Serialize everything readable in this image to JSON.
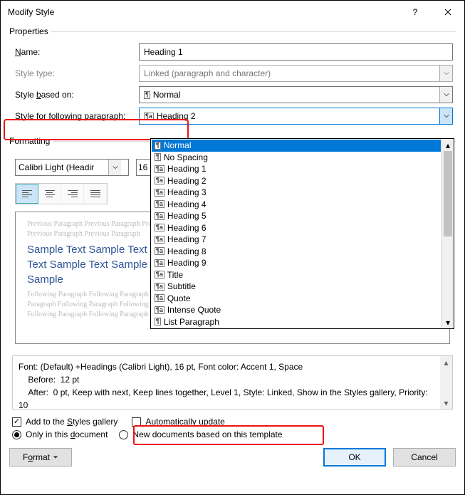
{
  "title": "Modify Style",
  "propsLegend": "Properties",
  "labels": {
    "name": "Name:",
    "type": "Style type:",
    "based": "Style based on:",
    "follow": "Style for following paragraph:"
  },
  "values": {
    "name": "Heading 1",
    "type": "Linked (paragraph and character)",
    "based": "Normal",
    "follow": "Heading 2"
  },
  "dropdownItems": [
    {
      "label": "Normal",
      "sel": true,
      "icon": "pilnormal"
    },
    {
      "label": "No Spacing",
      "icon": "pilnormal"
    },
    {
      "label": "Heading 1",
      "icon": "pil"
    },
    {
      "label": "Heading 2",
      "icon": "pil"
    },
    {
      "label": "Heading 3",
      "icon": "pil"
    },
    {
      "label": "Heading 4",
      "icon": "pil"
    },
    {
      "label": "Heading 5",
      "icon": "pil"
    },
    {
      "label": "Heading 6",
      "icon": "pil"
    },
    {
      "label": "Heading 7",
      "icon": "pil"
    },
    {
      "label": "Heading 8",
      "icon": "pil"
    },
    {
      "label": "Heading 9",
      "icon": "pil"
    },
    {
      "label": "Title",
      "icon": "pil"
    },
    {
      "label": "Subtitle",
      "icon": "pil"
    },
    {
      "label": "Quote",
      "icon": "pil"
    },
    {
      "label": "Intense Quote",
      "icon": "pil"
    },
    {
      "label": "List Paragraph",
      "icon": "pilnormal"
    }
  ],
  "formattingLegend": "Formatting",
  "font": {
    "name": "Calibri Light (Headir",
    "size": "16"
  },
  "previewGrayTop": "Previous Paragraph Previous Paragraph Previous Paragraph Previous Paragraph Previous Paragraph Previous Paragraph Previous Paragraph Previous Paragraph Previous Paragraph",
  "previewBlue1": "Sample Text Sample Text Sample Text Sample Text Sample Text Sample Text Sample Text Sample Text Sample Text Sample Text Sample Text Sample Text Sample Text Sample",
  "previewGrayBot": "Following Paragraph Following Paragraph Following Paragraph Following Paragraph Following Paragraph Following Paragraph Following Paragraph Following Paragraph Following Paragraph Following Paragraph Following Paragraph Following Paragraph Following Paragraph Following Paragraph Following Paragraph",
  "desc": {
    "l1": "Font: (Default) +Headings (Calibri Light), 16 pt, Font color: Accent 1, Space",
    "l2": "    Before:  12 pt",
    "l3": "    After:  0 pt, Keep with next, Keep lines together, Level 1, Style: Linked, Show in the Styles gallery, Priority: 10"
  },
  "checks": {
    "gallery": "Add to the Styles gallery",
    "auto": "Automatically update"
  },
  "radios": {
    "doc": "Only in this document",
    "tpl": "New documents based on this template"
  },
  "buttons": {
    "format": "Format",
    "ok": "OK",
    "cancel": "Cancel"
  }
}
